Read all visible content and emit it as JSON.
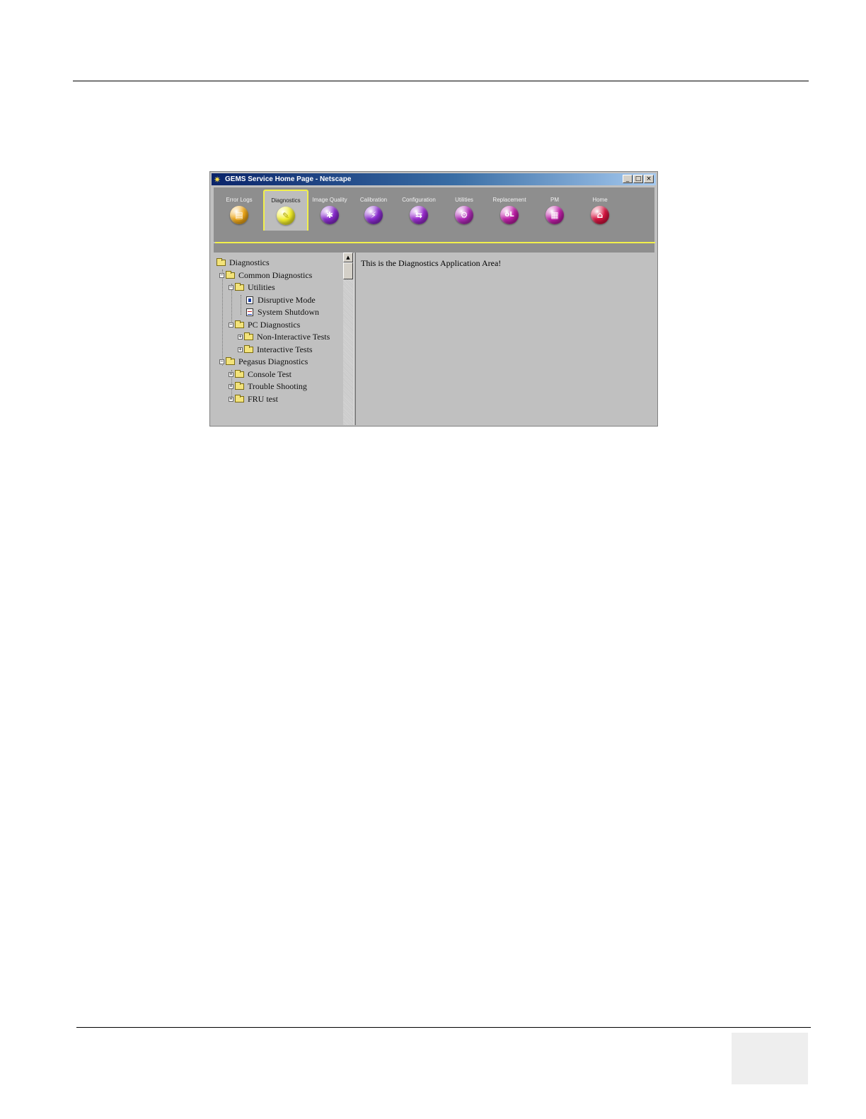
{
  "window": {
    "title": "GEMS Service Home Page - Netscape",
    "controls": {
      "minimize": "_",
      "maximize": "□",
      "close": "×"
    }
  },
  "toolbar": {
    "active_tab": "Diagnostics",
    "tabs": [
      {
        "label": "Error Logs",
        "icon": "error-logs-icon",
        "color": "#f0a818",
        "glyph": "▤"
      },
      {
        "label": "Diagnostics",
        "icon": "diagnostics-icon",
        "color": "#f2ee2a",
        "glyph": "✎"
      },
      {
        "label": "Image Quality",
        "icon": "image-quality-icon",
        "color": "#8a2bd0",
        "glyph": "✱"
      },
      {
        "label": "Calibration",
        "icon": "calibration-icon",
        "color": "#8a2bd0",
        "glyph": "⚡"
      },
      {
        "label": "Configuration",
        "icon": "configuration-icon",
        "color": "#9a2bd0",
        "glyph": "⇆"
      },
      {
        "label": "Utilities",
        "icon": "utilities-icon",
        "color": "#b02ab8",
        "glyph": "⚙"
      },
      {
        "label": "Replacement",
        "icon": "replacement-icon",
        "color": "#c01ea8",
        "glyph": "oL"
      },
      {
        "label": "PM",
        "icon": "pm-icon",
        "color": "#c01ea8",
        "glyph": "▦"
      },
      {
        "label": "Home",
        "icon": "home-icon",
        "color": "#d81440",
        "glyph": "⌂"
      }
    ]
  },
  "tree": {
    "items": [
      {
        "label": "Diagnostics",
        "type": "folder-open",
        "expander": ""
      },
      {
        "label": "Common Diagnostics",
        "type": "folder-open",
        "expander": "−"
      },
      {
        "label": "Utilities",
        "type": "folder-open",
        "expander": "−"
      },
      {
        "label": "Disruptive Mode",
        "type": "page-blue",
        "expander": ""
      },
      {
        "label": "System Shutdown",
        "type": "page-red",
        "expander": ""
      },
      {
        "label": "PC Diagnostics",
        "type": "folder-open",
        "expander": "−"
      },
      {
        "label": "Non-Interactive Tests",
        "type": "folder",
        "expander": "+"
      },
      {
        "label": "Interactive Tests",
        "type": "folder",
        "expander": "+"
      },
      {
        "label": "Pegasus Diagnostics",
        "type": "folder-open",
        "expander": "−"
      },
      {
        "label": "Console Test",
        "type": "folder",
        "expander": "+"
      },
      {
        "label": "Trouble Shooting",
        "type": "folder",
        "expander": "+"
      },
      {
        "label": "FRU test",
        "type": "folder",
        "expander": "+"
      }
    ]
  },
  "app_area": {
    "message": "This is the Diagnostics Application Area!"
  },
  "scrollbar": {
    "up_arrow": "▲"
  }
}
